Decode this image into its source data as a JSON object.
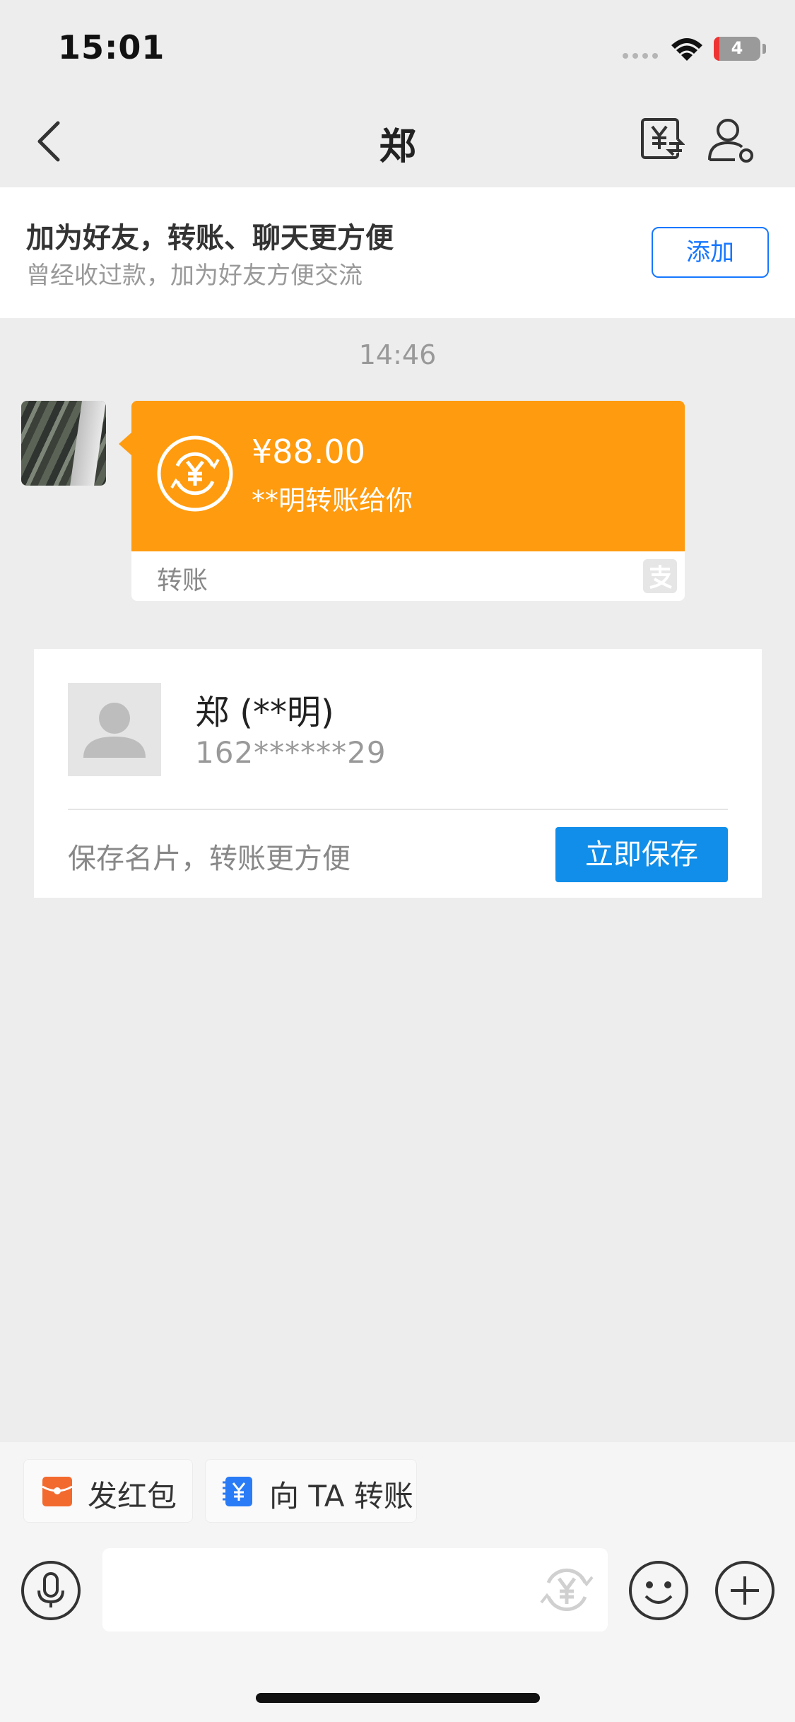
{
  "status_bar": {
    "time": "15:01",
    "battery": "4"
  },
  "nav": {
    "title": "郑",
    "back_icon": "chevron-left-icon",
    "transfer_icon": "yuan-exchange-icon",
    "profile_icon": "user-settings-icon"
  },
  "friend_banner": {
    "title": "加为好友，转账、聊天更方便",
    "subtitle": "曾经收过款，加为好友方便交流",
    "add_label": "添加"
  },
  "chat": {
    "timestamp": "14:46",
    "transfer": {
      "amount": "¥88.00",
      "description": "**明转账给你",
      "label": "转账",
      "color": "#ff9b0f"
    }
  },
  "contact_card": {
    "name": "郑 (**明)",
    "phone": "162******29",
    "hint": "保存名片，转账更方便",
    "save_label": "立即保存",
    "save_color": "#108ee9"
  },
  "quick_actions": [
    {
      "label": "发红包",
      "icon": "red-packet-icon"
    },
    {
      "label": "向 TA 转账",
      "icon": "transfer-icon"
    }
  ],
  "input_bar": {
    "icons": [
      "microphone-icon",
      "yuan-icon",
      "emoji-icon",
      "plus-icon"
    ]
  },
  "colors": {
    "accent": "#1677ff",
    "background": "#ededed"
  }
}
